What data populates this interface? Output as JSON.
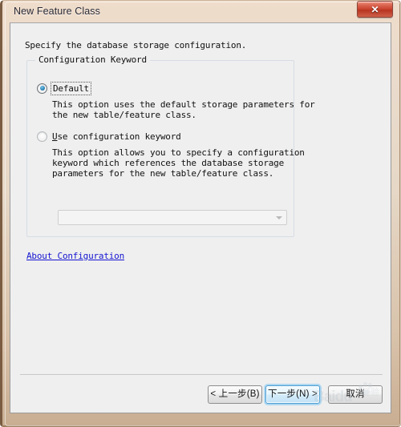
{
  "window": {
    "title": "New Feature Class",
    "close_icon": "close-icon",
    "close_glyph": "✕"
  },
  "colors": {
    "frame_border": "#7a5c42",
    "titlebar_gradient_start": "#efdccb",
    "titlebar_gradient_end": "#c9ae92",
    "close_button_red": "#c63f2a",
    "client_background": "#efefef",
    "link_blue": "#1414d2",
    "radio_dot_blue": "#2f86b9",
    "focus_glow_blue": "#78c3f0"
  },
  "content": {
    "instruction": "Specify the database storage configuration.",
    "group": {
      "legend": "Configuration Keyword",
      "options": [
        {
          "id": "default",
          "label": "Default",
          "accel": "",
          "label_prefix": "Default",
          "selected": true,
          "focused": true,
          "description": "This option uses the default storage parameters for\nthe new table/feature class."
        },
        {
          "id": "use-configuration-keyword",
          "label": "Use configuration keyword",
          "accel": "U",
          "label_rest": "se configuration keyword",
          "selected": false,
          "focused": false,
          "description": "This option allows you to specify a configuration\nkeyword which references the database storage\nparameters for the new table/feature class."
        }
      ],
      "combobox": {
        "value": "",
        "placeholder": "",
        "enabled": false,
        "arrow_icon": "chevron-down-icon"
      }
    },
    "link": {
      "label": "About Configuration",
      "href_text": "About Configuration"
    }
  },
  "footer": {
    "buttons": [
      {
        "id": "back",
        "label": "< 上一步(B)",
        "focused": false,
        "default": false
      },
      {
        "id": "next",
        "label": "下一步(N) >",
        "focused": true,
        "default": true
      },
      {
        "id": "cancel",
        "label": "取消",
        "focused": false,
        "default": false
      }
    ]
  },
  "watermark": {
    "text": "Baidu",
    "sub": "经验",
    "paw_icon": "paw-icon"
  }
}
